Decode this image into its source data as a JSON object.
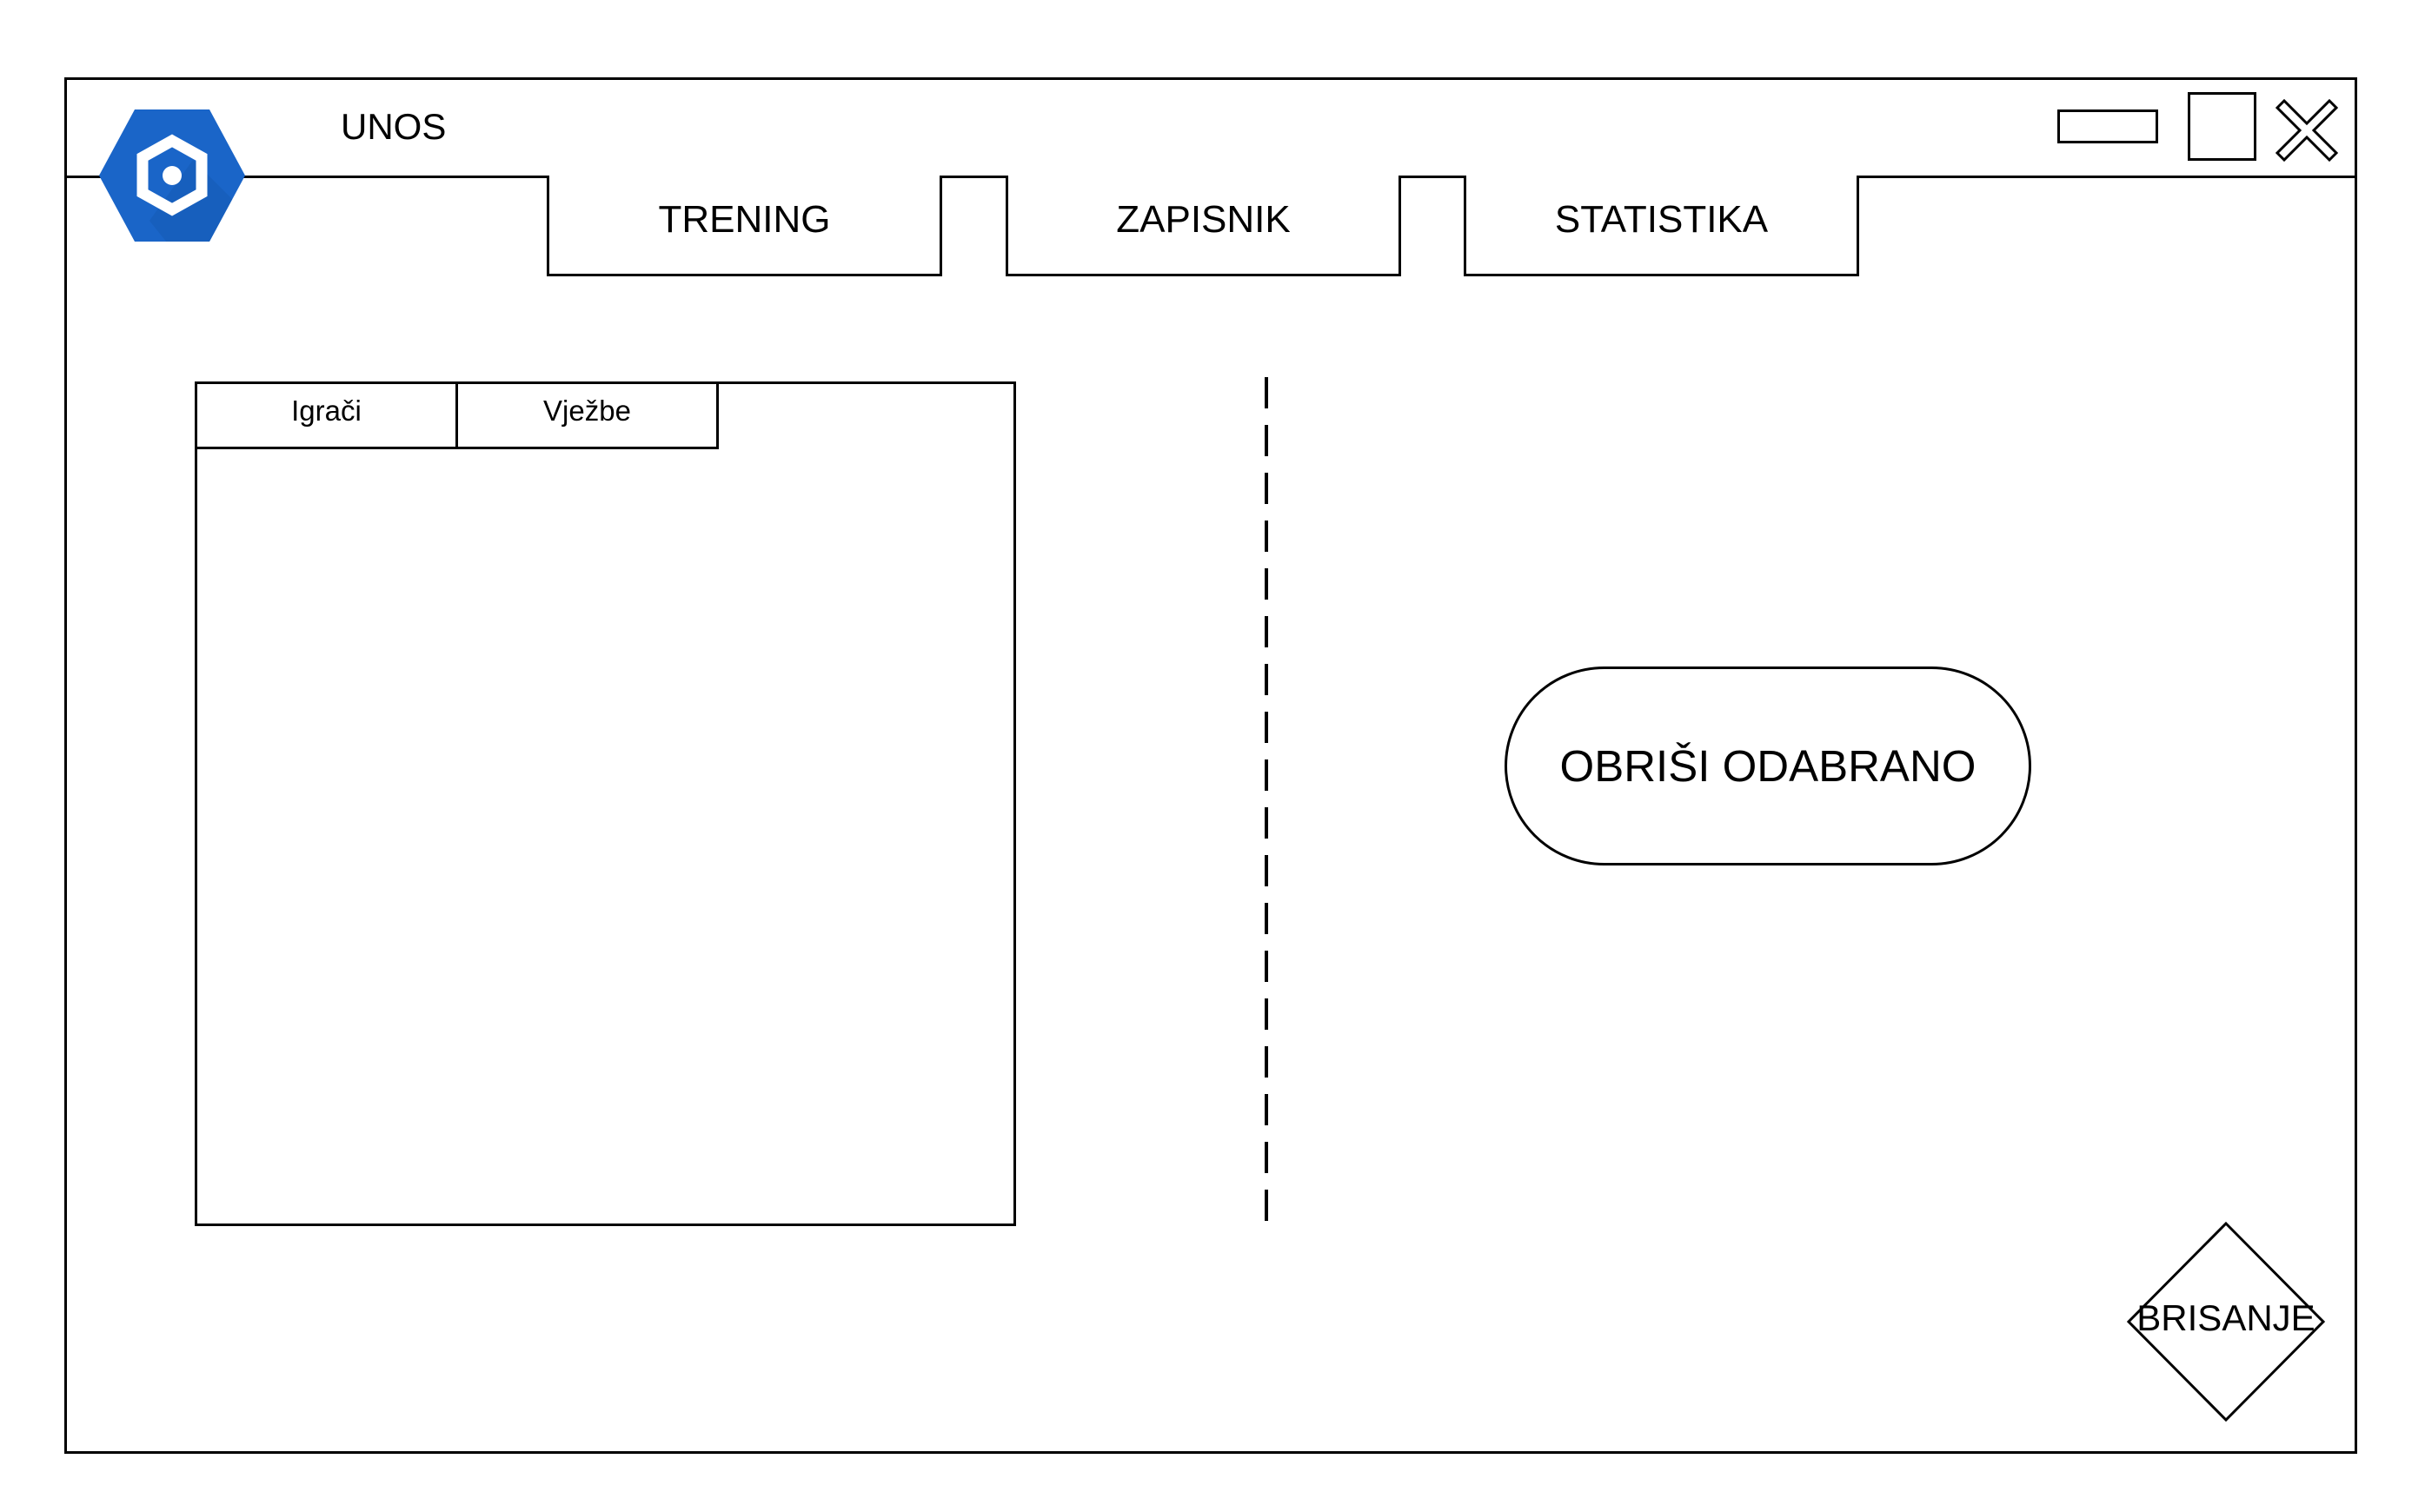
{
  "window": {
    "title": "UNOS",
    "accent_color": "#1a65c8"
  },
  "window_controls": {
    "minimize_icon": "minimize-icon",
    "maximize_icon": "maximize-icon",
    "close_icon": "close-icon"
  },
  "nav": {
    "tabs": [
      {
        "label": "TRENING"
      },
      {
        "label": "ZAPISNIK"
      },
      {
        "label": "STATISTIKA"
      }
    ]
  },
  "list_panel": {
    "tabs": [
      {
        "label": "Igrači"
      },
      {
        "label": "Vježbe"
      }
    ],
    "items": []
  },
  "actions": {
    "delete_selected_label": "OBRIŠI ODABRANO",
    "delete_label": "BRISANJE"
  }
}
